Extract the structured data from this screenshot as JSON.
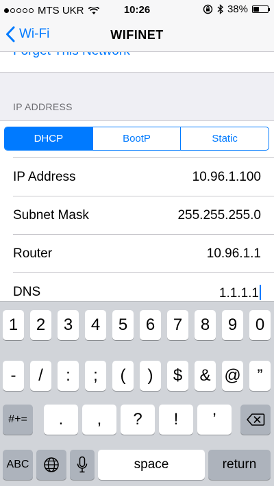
{
  "status_bar": {
    "carrier": "MTS UKR",
    "time": "10:26",
    "battery": "38%",
    "battery_level": 0.38
  },
  "nav": {
    "back_label": "Wi-Fi",
    "title": "WIFINET"
  },
  "forget_label": "Forget This Network",
  "section_header": "IP ADDRESS",
  "segments": [
    {
      "label": "DHCP",
      "selected": true
    },
    {
      "label": "BootP",
      "selected": false
    },
    {
      "label": "Static",
      "selected": false
    }
  ],
  "fields": [
    {
      "label": "IP Address",
      "value": "10.96.1.100"
    },
    {
      "label": "Subnet Mask",
      "value": "255.255.255.0"
    },
    {
      "label": "Router",
      "value": "10.96.1.1"
    },
    {
      "label": "DNS",
      "value": "1.1.1.1"
    }
  ],
  "keyboard": {
    "row1": [
      "1",
      "2",
      "3",
      "4",
      "5",
      "6",
      "7",
      "8",
      "9",
      "0"
    ],
    "row2": [
      "-",
      "/",
      ":",
      ";",
      "(",
      ")",
      "$",
      "&",
      "@",
      "”"
    ],
    "row3": [
      ".",
      ",",
      "?",
      "!",
      "’"
    ],
    "symbols_key": "#+=",
    "abc_key": "ABC",
    "space_key": "space",
    "return_key": "return"
  },
  "colors": {
    "accent": "#007aff",
    "background": "#efeff4",
    "keyboard": "#d1d4d9"
  }
}
